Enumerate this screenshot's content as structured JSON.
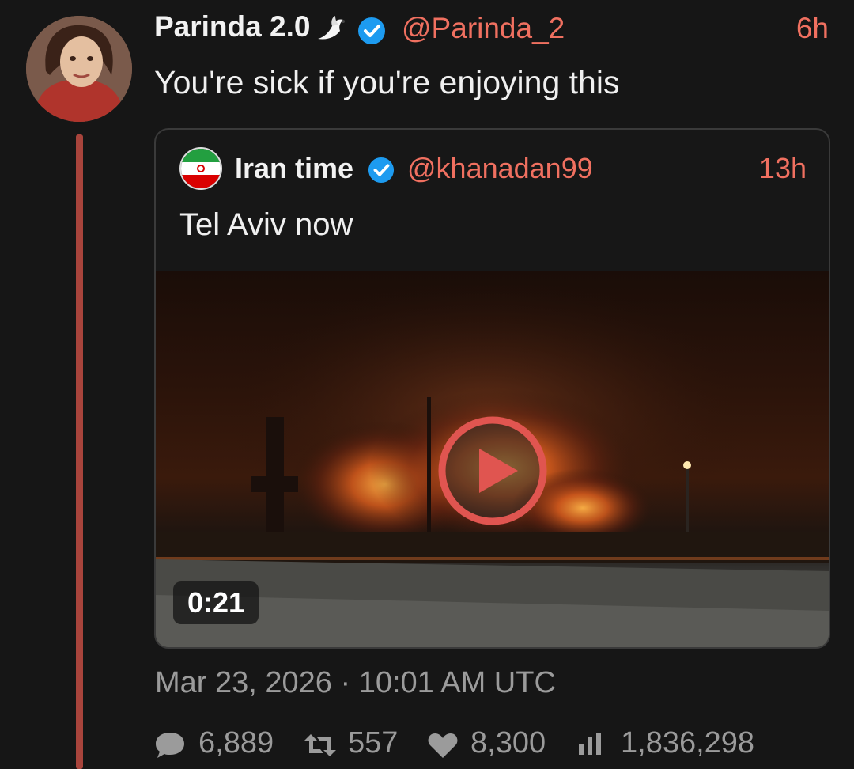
{
  "tweet": {
    "author_name": "Parinda 2.0",
    "author_handle": "@Parinda_2",
    "time_ago": "6h",
    "text": "You're sick if you're enjoying this"
  },
  "quoted": {
    "author_name": "Iran time",
    "author_handle": "@khanadan99",
    "time_ago": "13h",
    "text": "Tel Aviv now",
    "video_duration": "0:21"
  },
  "timestamp": "Mar 23, 2026 · 10:01 AM UTC",
  "stats": {
    "replies": "6,889",
    "retweets": "557",
    "likes": "8,300",
    "views": "1,836,298"
  },
  "colors": {
    "accent": "#f07060",
    "thread_line": "#a8443c",
    "verified": "#1d9bf0",
    "muted": "#9b9b9b"
  },
  "icons": [
    "dove-icon",
    "verified-icon",
    "iran-flag-icon",
    "play-icon",
    "reply-icon",
    "retweet-icon",
    "like-icon",
    "views-icon"
  ]
}
